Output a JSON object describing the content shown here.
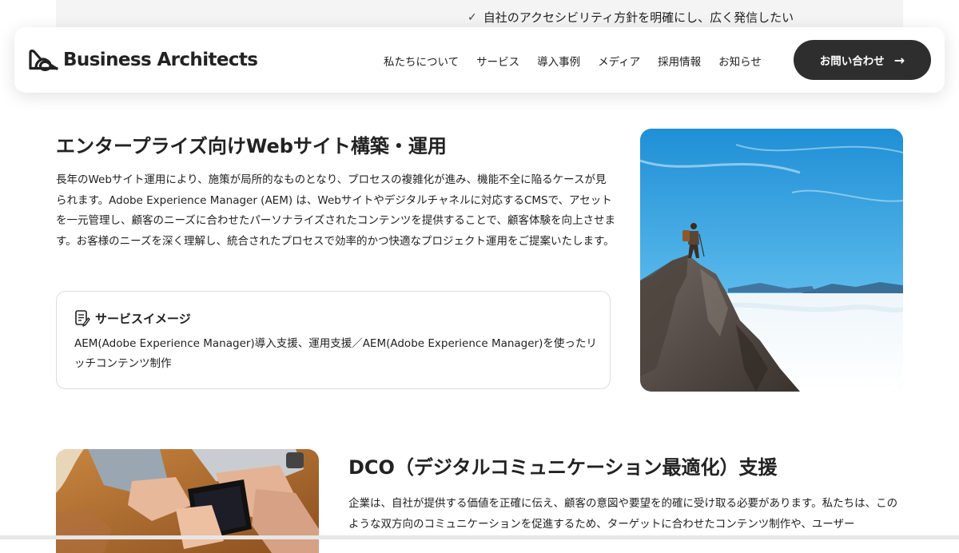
{
  "top_item": {
    "check_icon": "check-icon",
    "text": "自社のアクセシビリティ方針を明確にし、広く発信したい"
  },
  "header": {
    "logo_text": "Business Architects",
    "nav": [
      "私たちについて",
      "サービス",
      "導入事例",
      "メディア",
      "採用情報",
      "お知らせ"
    ],
    "cta_label": "お問い合わせ",
    "cta_icon": "arrow-right-icon",
    "cta_color": "#2e2e2e"
  },
  "section1": {
    "title": "エンタープライズ向けWebサイト構築・運用",
    "body": "長年のWebサイト運用により、施策が局所的なものとなり、プロセスの複雑化が進み、機能不全に陥るケースが見られます。Adobe Experience Manager (AEM) は、Webサイトやデジタルチャネルに対応するCMSで、アセットを一元管理し、顧客のニーズに合わせたパーソナライズされたコンテンツを提供することで、顧客体験を向上させます。お客様のニーズを深く理解し、統合されたプロセスで効率的かつ快適なプロジェクト運用をご提案いたします。",
    "service_box": {
      "icon": "memo-icon",
      "title": "サービスイメージ",
      "desc": "AEM(Adobe Experience Manager)導入支援、運用支援／AEM(Adobe Experience Manager)を使ったリッチコンテンツ制作"
    }
  },
  "section2": {
    "title": "DCO（デジタルコミュニケーション最適化）支援",
    "body": "企業は、自社が提供する価値を正確に伝え、顧客の意図や要望を的確に受け取る必要があります。私たちは、このような双方向のコミュニケーションを促進するため、ターゲットに合わせたコンテンツ制作や、ユーザー"
  }
}
